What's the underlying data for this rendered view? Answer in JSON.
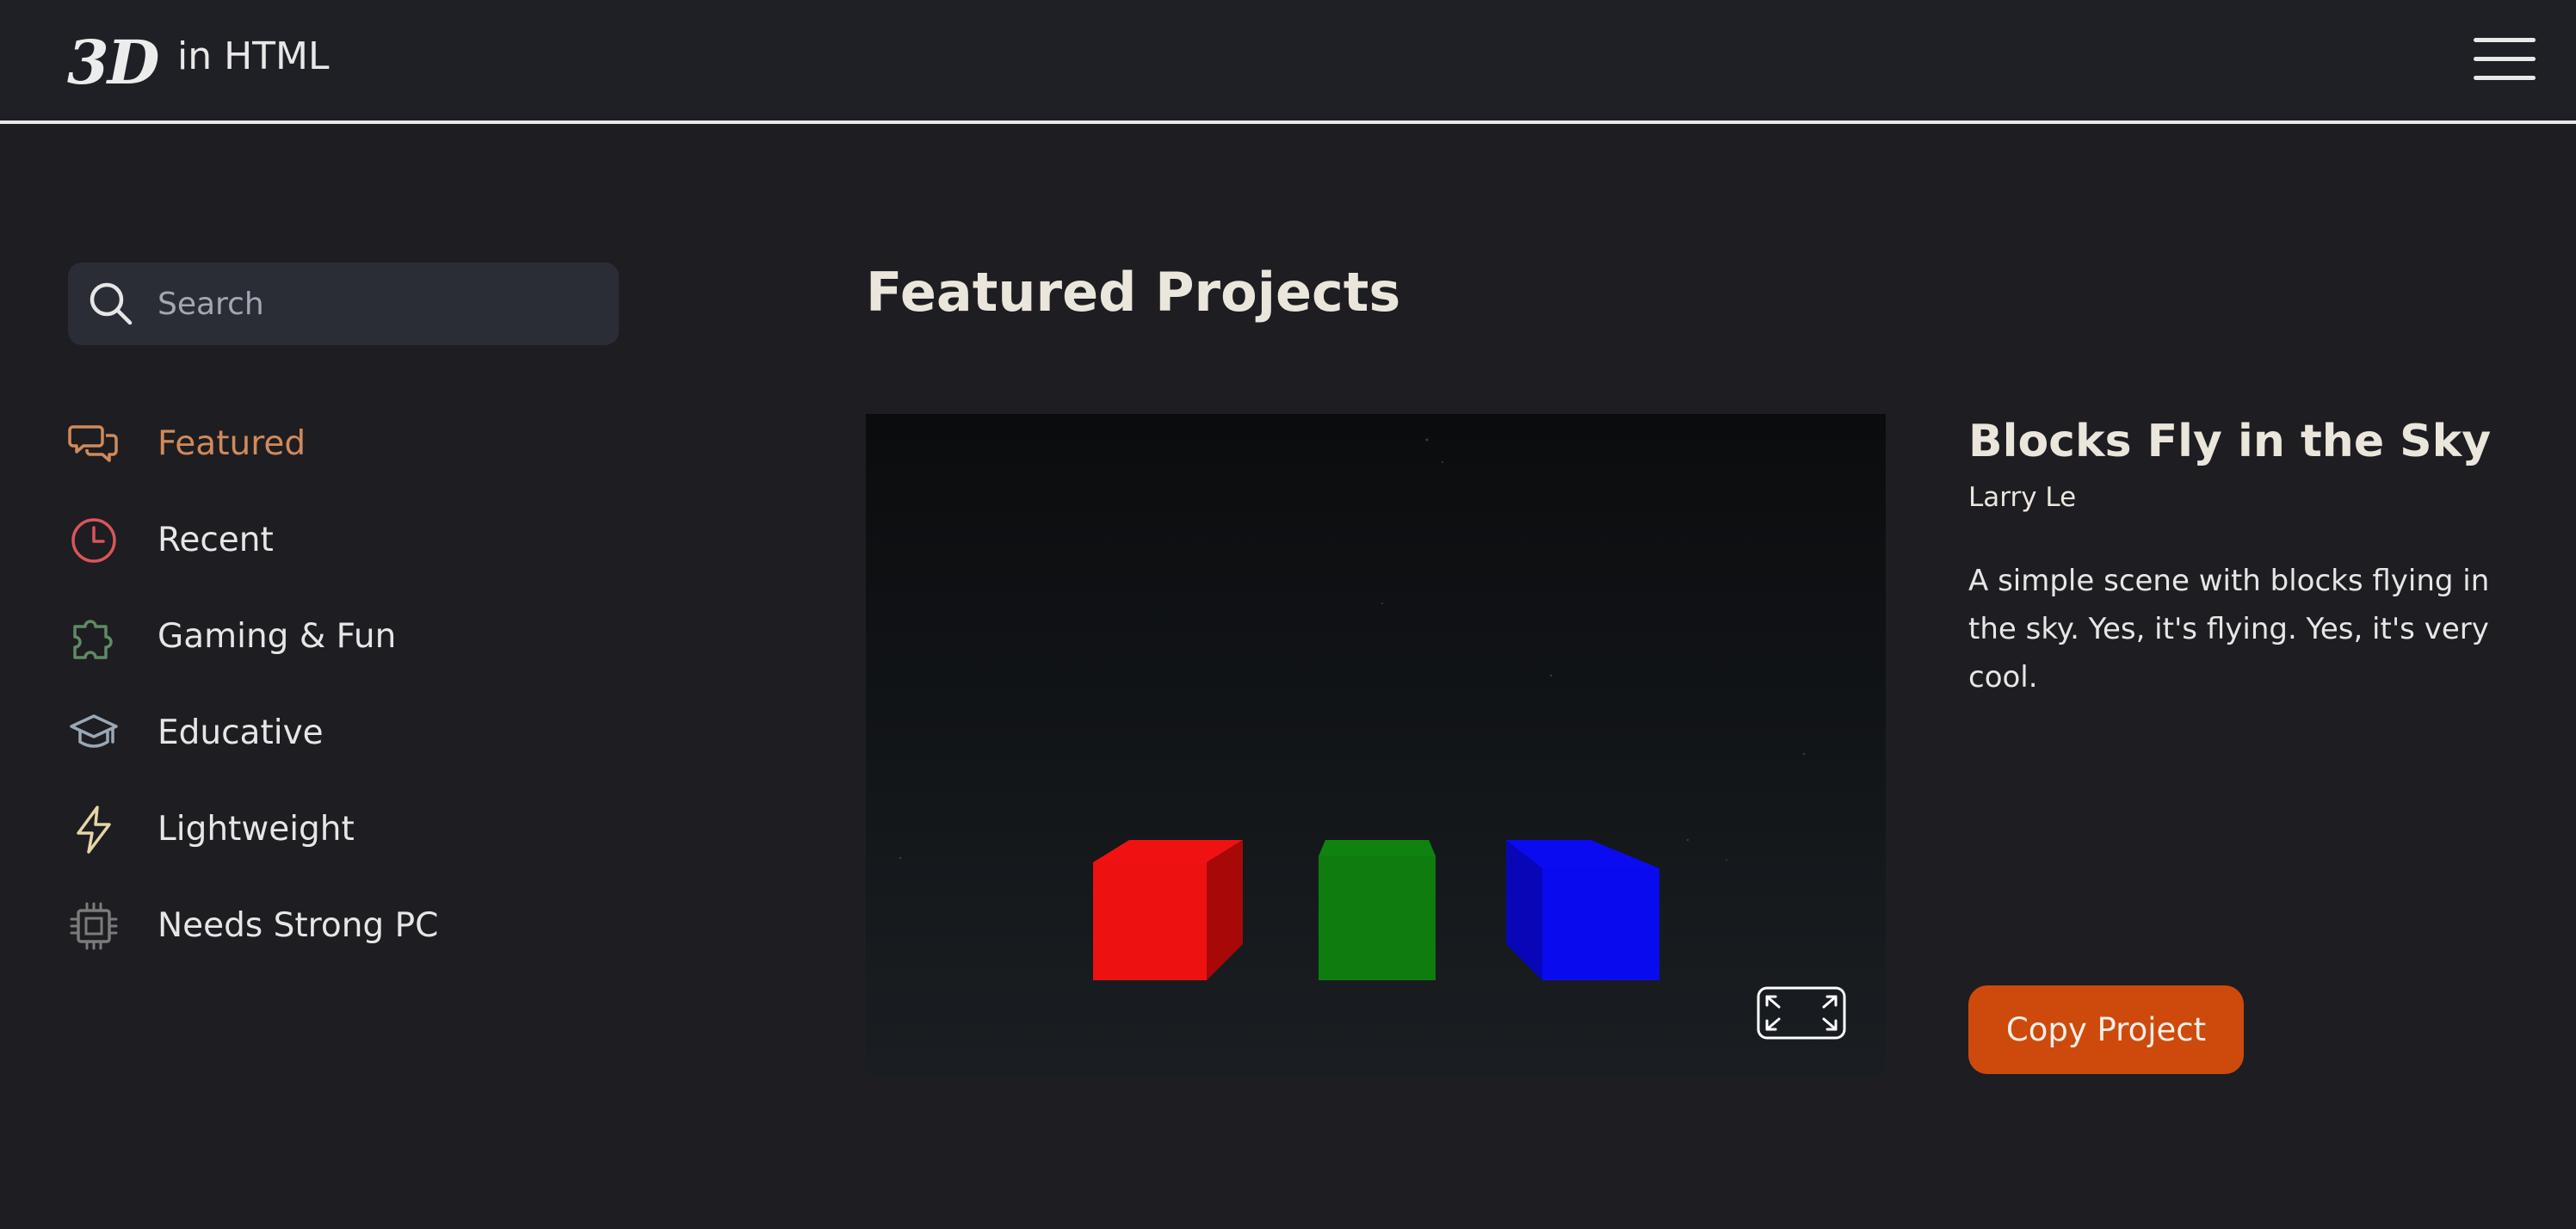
{
  "header": {
    "logo_mark": "3D",
    "logo_text": "in HTML",
    "menu_icon": "hamburger-menu-icon"
  },
  "sidebar": {
    "search": {
      "placeholder": "Search",
      "icon": "search-icon"
    },
    "items": [
      {
        "label": "Featured",
        "icon": "chat-bubbles-icon",
        "color": "#d08a5b",
        "active": true
      },
      {
        "label": "Recent",
        "icon": "clock-icon",
        "color": "#d9555a",
        "active": false
      },
      {
        "label": "Gaming & Fun",
        "icon": "puzzle-icon",
        "color": "#5f8a64",
        "active": false
      },
      {
        "label": "Educative",
        "icon": "graduation-cap-icon",
        "color": "#9aa7b5",
        "active": false
      },
      {
        "label": "Lightweight",
        "icon": "lightning-icon",
        "color": "#e7d4a6",
        "active": false
      },
      {
        "label": "Needs Strong PC",
        "icon": "cpu-chip-icon",
        "color": "#7b7b7b",
        "active": false
      }
    ]
  },
  "main": {
    "section_title": "Featured Projects",
    "project": {
      "title": "Blocks Fly in the Sky",
      "author": "Larry Le",
      "description": "A simple scene with blocks flying in the sky. Yes, it's flying. Yes, it's very cool.",
      "copy_button_label": "Copy Project",
      "copy_button_color": "#cd4a0c",
      "fullscreen_icon": "fullscreen-icon",
      "scene_blocks": [
        {
          "name": "red-block",
          "color": "#e81010"
        },
        {
          "name": "green-block",
          "color": "#0e7c0e"
        },
        {
          "name": "blue-block",
          "color": "#0b0bf2"
        }
      ]
    }
  },
  "colors": {
    "background": "#1d1d22",
    "header_background": "#1f2026",
    "search_background": "#2a2d36",
    "accent": "#d08a5b"
  }
}
